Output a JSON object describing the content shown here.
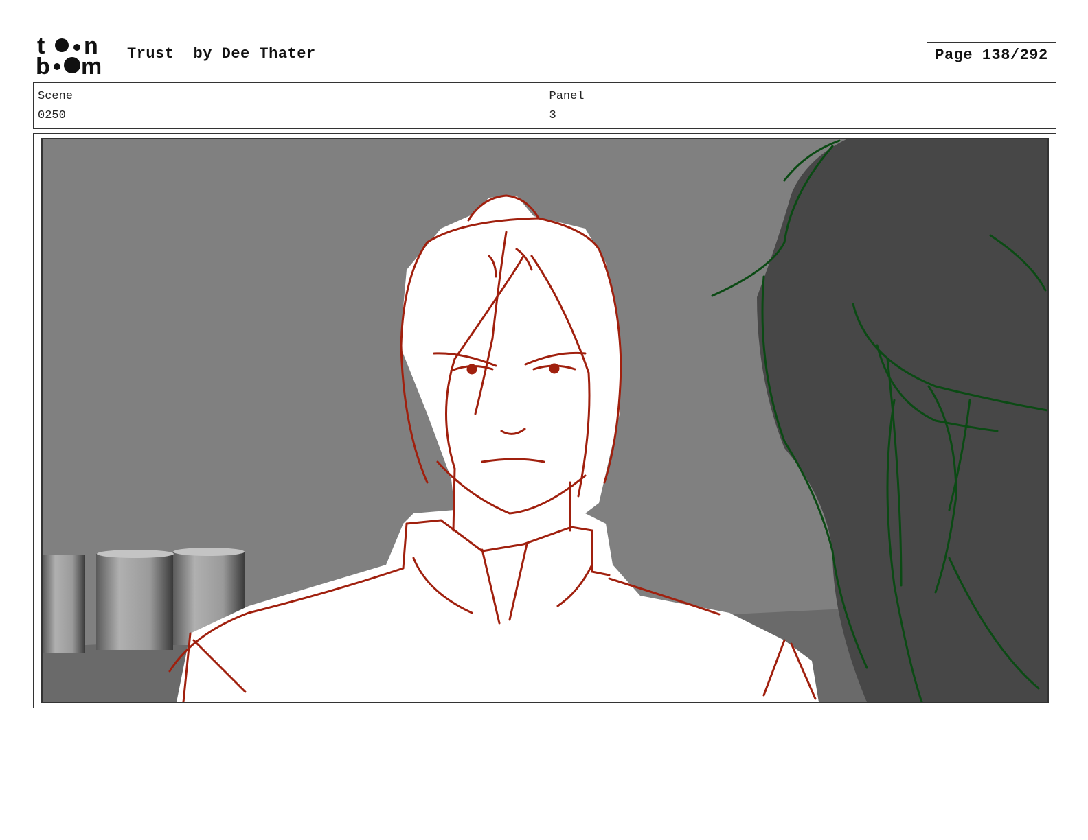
{
  "header": {
    "logo_text_top": "toon",
    "logo_text_bottom": "boom",
    "title": "Trust",
    "author": "by Dee Thater",
    "page": "Page 138/292"
  },
  "info": {
    "scene_label": "Scene",
    "scene_value": "0250",
    "panel_label": "Panel",
    "panel_value": "3"
  },
  "drawing": {
    "background_color": "#808080",
    "foreground_character_color": "#0b4a14",
    "main_character_line_color": "#a0200e",
    "dark_figure_color": "#474747"
  }
}
